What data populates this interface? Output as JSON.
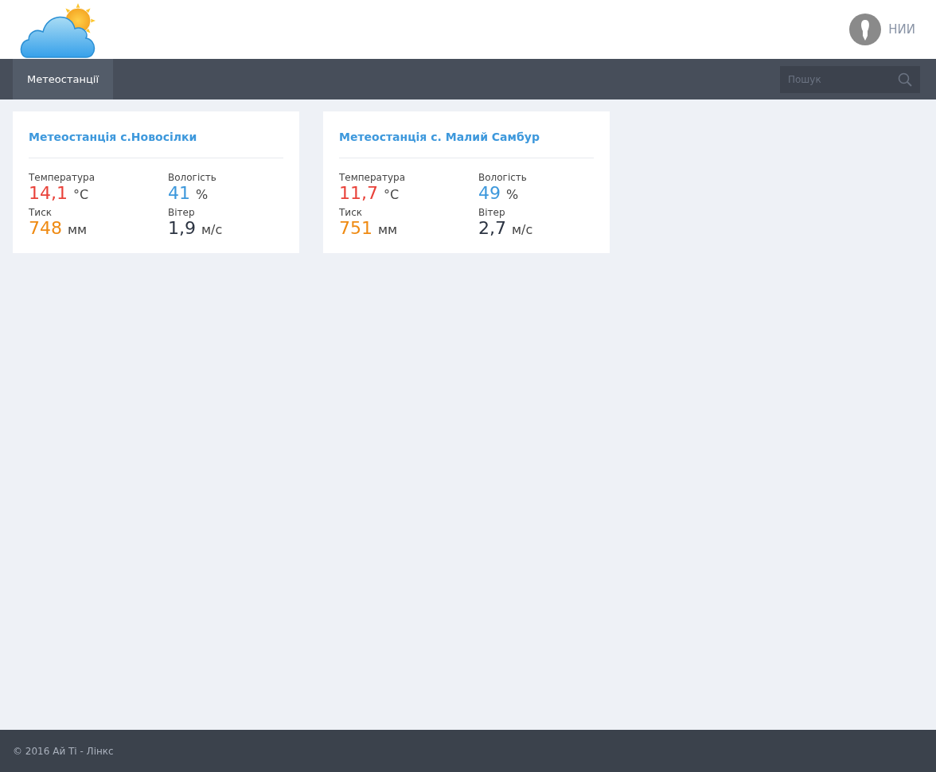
{
  "header": {
    "user": {
      "name": "НИИ"
    }
  },
  "nav": {
    "tabs": [
      {
        "label": "Метеостанції",
        "selected": true
      }
    ],
    "search": {
      "placeholder": "Пошук"
    }
  },
  "stations": [
    {
      "title": "Метеостанція с.Новосілки",
      "readings": [
        {
          "kind": "temperature",
          "label": "Температура",
          "value": "14,1",
          "unit": "°C"
        },
        {
          "kind": "humidity",
          "label": "Вологість",
          "value": "41",
          "unit": "%"
        },
        {
          "kind": "pressure",
          "label": "Тиск",
          "value": "748",
          "unit": "мм"
        },
        {
          "kind": "wind",
          "label": "Вітер",
          "value": "1,9",
          "unit": "м/с"
        }
      ]
    },
    {
      "title": "Метеостанція с. Малий Самбур",
      "readings": [
        {
          "kind": "temperature",
          "label": "Температура",
          "value": "11,7",
          "unit": "°C"
        },
        {
          "kind": "humidity",
          "label": "Вологість",
          "value": "49",
          "unit": "%"
        },
        {
          "kind": "pressure",
          "label": "Тиск",
          "value": "751",
          "unit": "мм"
        },
        {
          "kind": "wind",
          "label": "Вітер",
          "value": "2,7",
          "unit": "м/с"
        }
      ]
    }
  ],
  "footer": {
    "text": "© 2016 Ай Ті - Лінкс"
  }
}
